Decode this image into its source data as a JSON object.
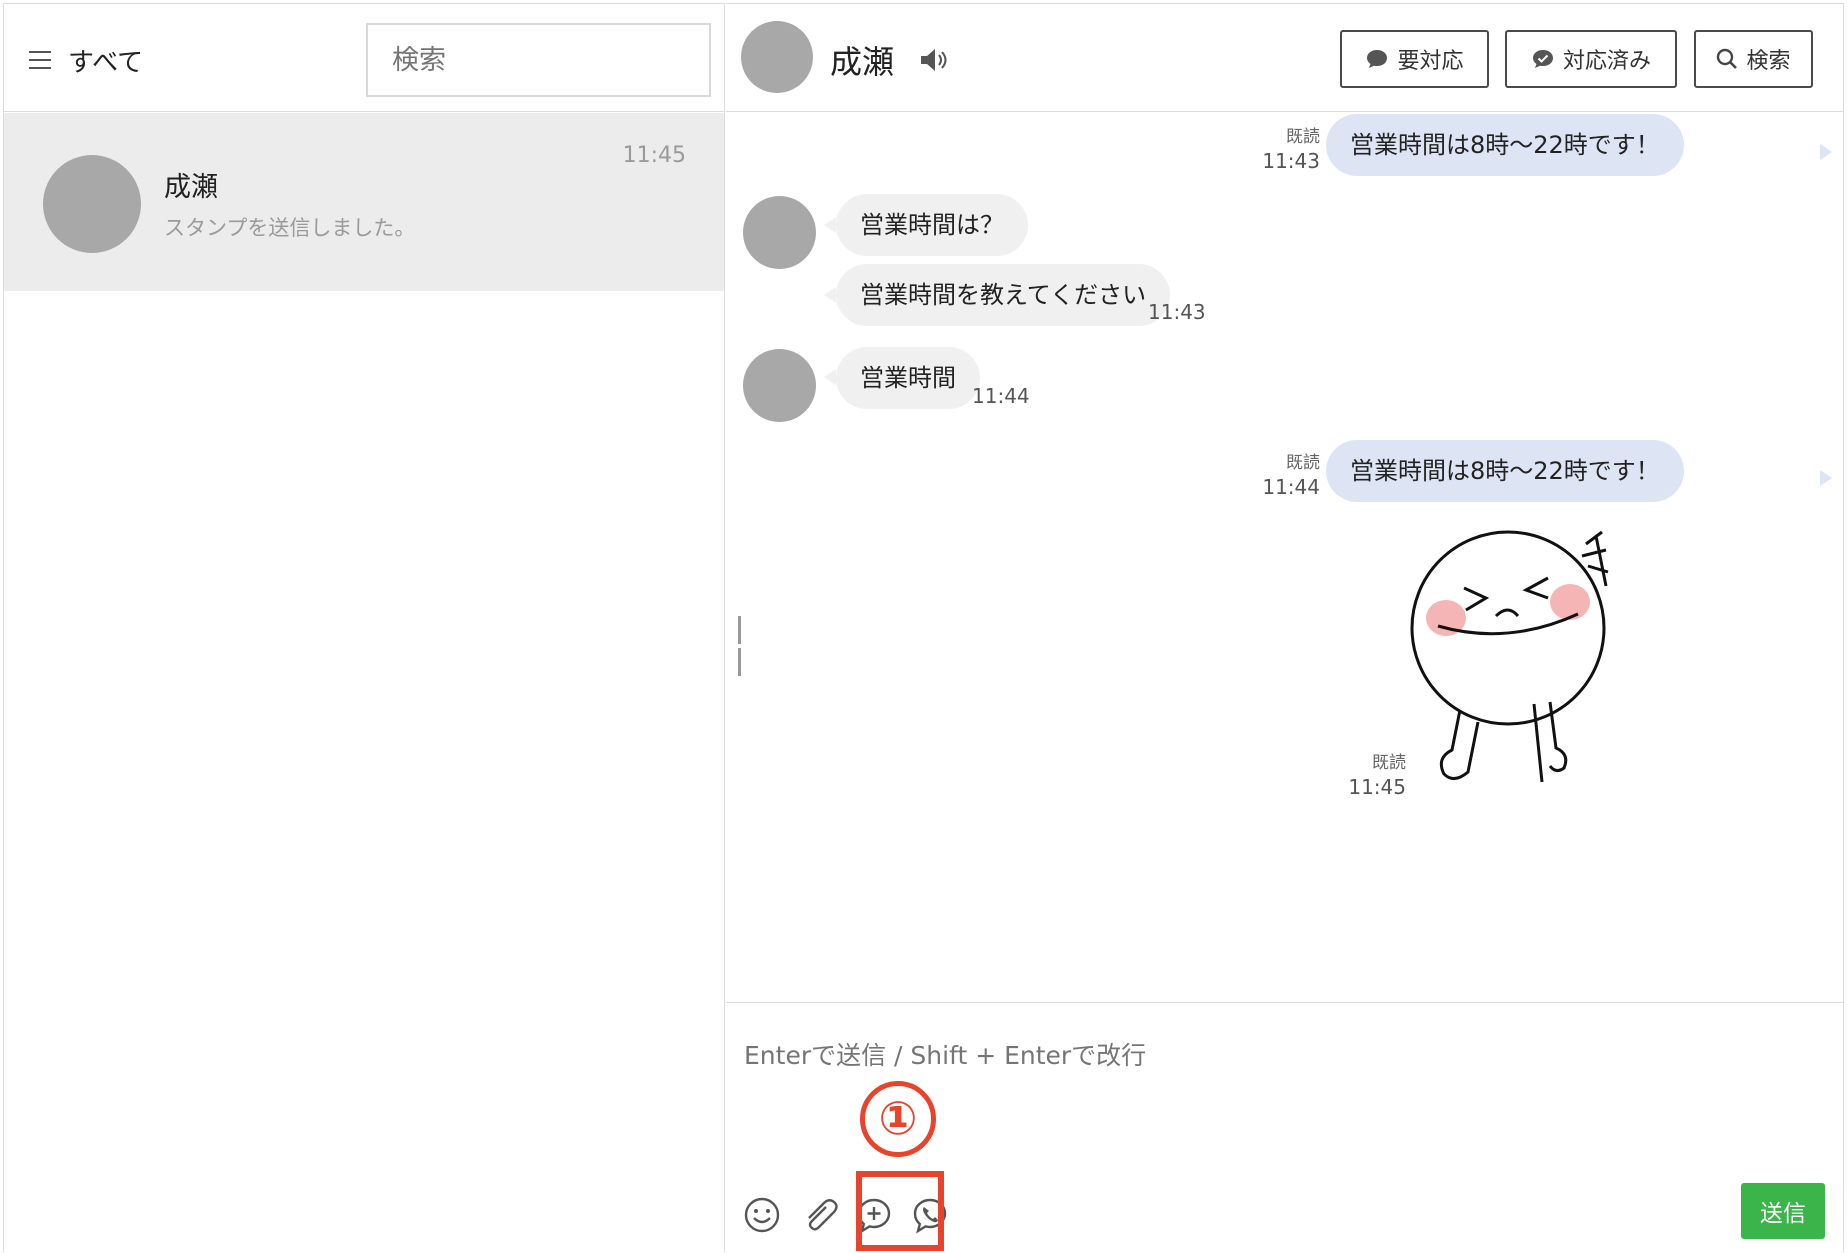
{
  "sidebar": {
    "filter_label": "すべて",
    "search_placeholder": "検索",
    "chats": [
      {
        "name": "成瀬",
        "preview": "スタンプを送信しました。",
        "time": "11:45"
      }
    ]
  },
  "chat": {
    "contact_name": "成瀬",
    "buttons": {
      "needs_action": "要対応",
      "done": "対応済み",
      "search": "検索"
    },
    "messages": [
      {
        "dir": "out",
        "text": "営業時間は8時〜22時です！",
        "read": "既読",
        "time": "11:43"
      },
      {
        "dir": "in",
        "text": "営業時間は？"
      },
      {
        "dir": "in",
        "text": "営業時間を教えてください",
        "time": "11:43"
      },
      {
        "dir": "in",
        "text": "営業時間",
        "time": "11:44"
      },
      {
        "dir": "out",
        "text": "営業時間は8時〜22時です！",
        "read": "既読",
        "time": "11:44"
      },
      {
        "dir": "out",
        "type": "sticker",
        "read": "既読",
        "time": "11:45"
      }
    ],
    "composer_placeholder": "Enterで送信 / Shift + Enterで改行",
    "send_label": "送信"
  },
  "annotation": {
    "number": "①",
    "color": "#e8432b"
  },
  "colors": {
    "send": "#3bb54a",
    "bubble_out": "#dde4f4",
    "bubble_in": "#f0f0f1",
    "avatar": "#a8a8a8"
  }
}
